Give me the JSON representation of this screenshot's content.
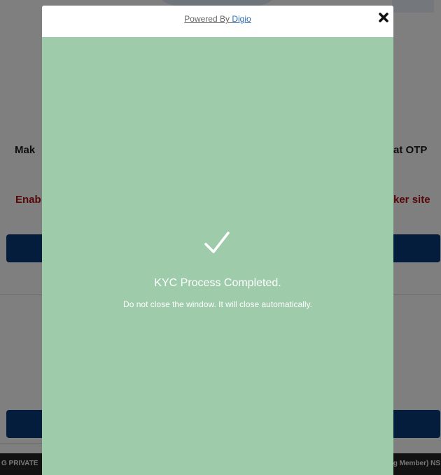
{
  "background": {
    "line1_left": "Mak",
    "line1_right": "at OTP",
    "line2_left": "Enab",
    "line2_right": "ker site",
    "footer_left": "G PRIVATE",
    "footer_right": "g Member) NS"
  },
  "modal": {
    "powered_by_label": "Powered By ",
    "brand": "Digio",
    "close_glyph": "✖",
    "icon": "checkmark-icon",
    "title": "KYC Process Completed.",
    "subtitle": "Do not close the window. It will close automatically."
  },
  "colors": {
    "success_green": "#9ecbaa",
    "brand_link": "#2f6fb8",
    "bg_button": "#0b3a7a",
    "bg_alert_red": "#b00f0f"
  }
}
